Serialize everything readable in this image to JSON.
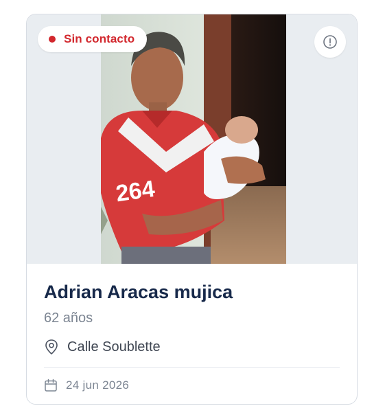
{
  "card": {
    "status_label": "Sin contacto",
    "status_color": "#d2272d",
    "name": "Adrian Aracas mujica",
    "age": "62 años",
    "location": "Calle Soublette",
    "date": "24 jun 2026",
    "photo_description": "person-photo",
    "jersey_number": "264"
  },
  "icons": {
    "status": "status-dot",
    "info": "info-circle-icon",
    "location": "map-pin-icon",
    "date": "calendar-icon"
  },
  "colors": {
    "name": "#17294a",
    "muted": "#7c8592",
    "border": "#d7dce3",
    "media_bg": "#e9edf1"
  }
}
